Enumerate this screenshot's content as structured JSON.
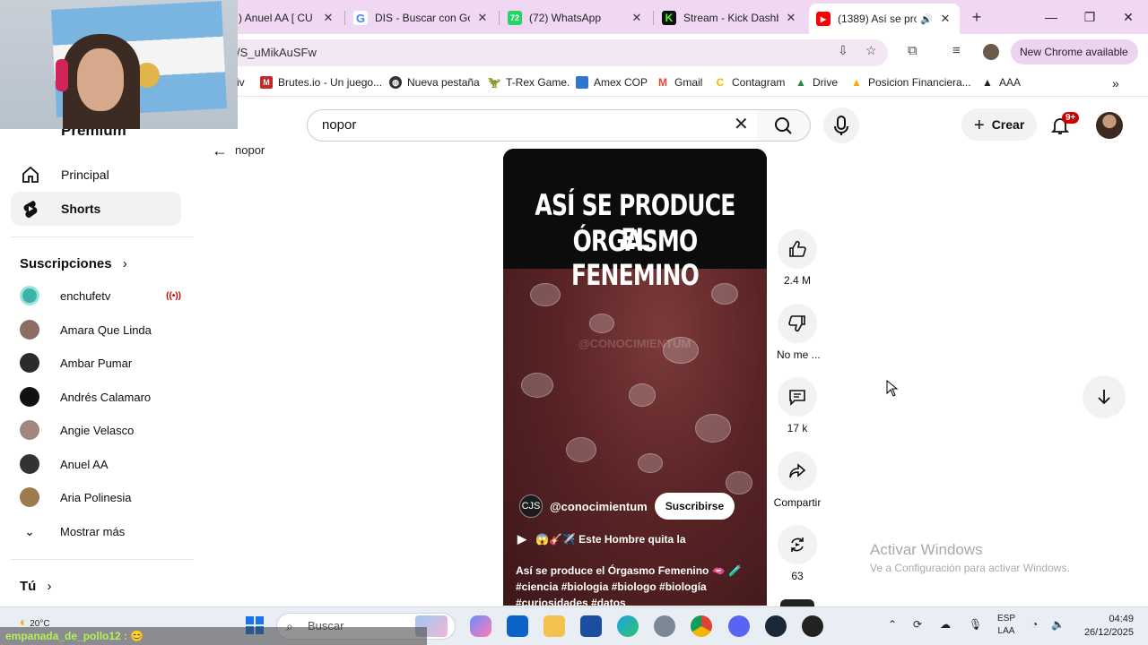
{
  "browser": {
    "tabs": [
      {
        "title": ") Anuel AA [ CU",
        "favicon": "youtube-icon",
        "color": "#ff0000"
      },
      {
        "title": "DIS - Buscar con Goo",
        "favicon": "google-icon",
        "color": "#4285f4"
      },
      {
        "title": "(72) WhatsApp",
        "favicon": "whatsapp-icon",
        "color": "#25d366",
        "badge": "72"
      },
      {
        "title": "Stream - Kick Dashbo",
        "favicon": "kick-icon",
        "color": "#53fc18"
      },
      {
        "title": "(1389) Así se prod",
        "favicon": "youtube-icon",
        "color": "#ff0000",
        "active": true
      }
    ],
    "url": "/S_uMikAuSFw",
    "new_chrome_label": "New Chrome available",
    "bookmarks": [
      {
        "label": "iv",
        "icon": "folder-icon"
      },
      {
        "label": "Brutes.io - Un juego...",
        "icon": "brutes-icon"
      },
      {
        "label": "Nueva pestaña",
        "icon": "globe-icon"
      },
      {
        "label": "T-Rex Game.",
        "icon": "trex-icon"
      },
      {
        "label": "Amex COP",
        "icon": "amex-icon"
      },
      {
        "label": "Gmail",
        "icon": "gmail-icon"
      },
      {
        "label": "Contagram",
        "icon": "contagram-icon"
      },
      {
        "label": "Drive",
        "icon": "drive-icon"
      },
      {
        "label": "Posicion Financiera...",
        "icon": "drive-icon"
      },
      {
        "label": "AAA",
        "icon": "aaa-icon"
      }
    ]
  },
  "youtube": {
    "logo_text": "Premium",
    "search_value": "nopor",
    "back_label": "nopor",
    "create_label": "Crear",
    "notifications_badge": "9+",
    "sidebar": {
      "main": [
        {
          "label": "Principal",
          "icon": "home-icon"
        },
        {
          "label": "Shorts",
          "icon": "shorts-icon",
          "selected": true
        }
      ],
      "subscriptions_header": "Suscripciones",
      "subscriptions": [
        {
          "name": "enchufetv",
          "live": true,
          "avatar_color": "#3bb3a8"
        },
        {
          "name": "Amara Que Linda",
          "avatar_color": "#8d6e63"
        },
        {
          "name": "Ambar Pumar",
          "avatar_color": "#2b2b2b"
        },
        {
          "name": "Andrés Calamaro",
          "avatar_color": "#111111"
        },
        {
          "name": "Angie Velasco",
          "avatar_color": "#a1887f"
        },
        {
          "name": "Anuel AA",
          "avatar_color": "#333333"
        },
        {
          "name": "Aria Polinesia",
          "avatar_color": "#9e7a4f"
        }
      ],
      "show_more_label": "Mostrar más",
      "you_label": "Tú"
    },
    "short": {
      "title_line1": "ASÍ SE PRODUCE EL",
      "title_line2": "ÓRGASMO FENEMINO",
      "watermark": "@CONOCIMIENTUM",
      "channel_logo": "CJS",
      "channel": "@conocimientum",
      "subscribe_label": "Suscribirse",
      "music": "😱🎸✈️ Este Hombre quita la",
      "description_line1": "Así se produce el Órgasmo Femenino 🫦 🧪",
      "description_line2": "#ciencia #biologia #biologo #biología",
      "description_line3": "#curiosidades #datos"
    },
    "actions": {
      "likes": "2.4 M",
      "dislike": "No me ...",
      "comments": "17 k",
      "share": "Compartir",
      "remix": "63"
    }
  },
  "windows": {
    "activate_title": "Activar Windows",
    "activate_sub": "Ve a Configuración para activar Windows.",
    "weather": "20°C",
    "search_placeholder": "Buscar",
    "lang_line1": "ESP",
    "lang_line2": "LAA",
    "time": "04:49",
    "date": "26/12/2025",
    "overlay_chat": "empanada_de_pollo12 : 😊"
  }
}
